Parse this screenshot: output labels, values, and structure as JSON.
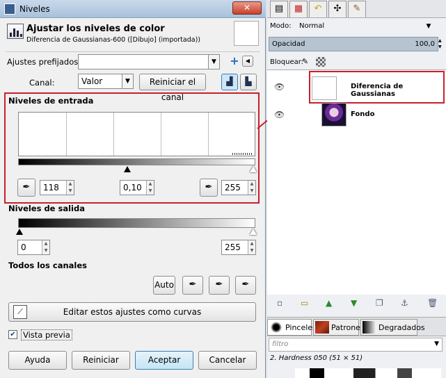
{
  "window": {
    "title": "Niveles",
    "close": "✕"
  },
  "header": {
    "title": "Ajustar los niveles de color",
    "subtitle": "Diferencia de Gaussianas-600 ([Dibujo] (importada))"
  },
  "presets": {
    "label": "Ajustes prefijados:",
    "value": ""
  },
  "channel": {
    "label": "Canal:",
    "value": "Valor",
    "reset_label": "Reiniciar el canal"
  },
  "input_levels": {
    "title": "Niveles de entrada",
    "low": "118",
    "gamma": "0,10",
    "high": "255"
  },
  "output_levels": {
    "title": "Niveles de salida",
    "low": "0",
    "high": "255"
  },
  "all_channels": {
    "title": "Todos los canales",
    "auto_label": "Auto"
  },
  "edit_curves_label": "Editar estos ajustes como curvas",
  "preview": {
    "label": "Vista previa",
    "checked": true
  },
  "buttons": {
    "help": "Ayuda",
    "reset": "Reiniciar",
    "ok": "Aceptar",
    "cancel": "Cancelar"
  },
  "layers_panel": {
    "mode_label": "Modo:",
    "mode_value": "Normal",
    "opacity_label": "Opacidad",
    "opacity_value": "100,0",
    "lock_label": "Bloquear:",
    "layers": [
      {
        "name": "Diferencia de Gaussianas",
        "visible": true,
        "selected": true
      },
      {
        "name": "Fondo",
        "visible": true,
        "selected": false
      }
    ]
  },
  "brushes_panel": {
    "tabs": [
      "Pinceles",
      "Patrones",
      "Degradados"
    ],
    "filter_placeholder": "filtro",
    "brush_info": "2. Hardness 050 (51 × 51)"
  },
  "colors": {
    "highlight_red": "#c8202a",
    "opacity_bar": "#b6c4d2"
  }
}
